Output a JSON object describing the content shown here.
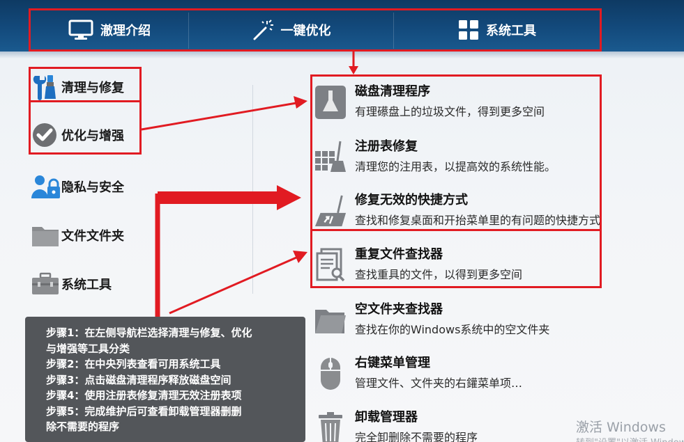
{
  "top_tabs": [
    {
      "label": "澈理介绍",
      "icon": "monitor-icon"
    },
    {
      "label": "一键优化",
      "icon": "magic-wand-icon"
    },
    {
      "label": "系统工具",
      "icon": "grid-icon"
    }
  ],
  "sidebar": {
    "items": [
      {
        "label": "清理与修复",
        "icon": "brush-wrench-icon"
      },
      {
        "label": "优化与增强",
        "icon": "check-circle-icon"
      },
      {
        "label": "隐私与安全",
        "icon": "user-lock-icon"
      },
      {
        "label": "文件文件夹",
        "icon": "folder-icon"
      },
      {
        "label": "系统工具",
        "icon": "toolbox-icon"
      }
    ]
  },
  "tools": [
    {
      "title": "磁盘清理程序",
      "desc": "有理礤盘上的垃圾文件，得到更多空间",
      "icon": "disk-cleanup-icon"
    },
    {
      "title": "注册表修复",
      "desc": "清理您的注用表，以提高效的系统性能。",
      "icon": "registry-repair-icon"
    },
    {
      "title": "修复无效的快捷方式",
      "desc": "查找和修复桌面和开抬菜单里的有问题的快捷方式",
      "icon": "shortcut-repair-icon"
    },
    {
      "title": "重复文件查找器",
      "desc": "查找重具的文件，以得到更多空间",
      "icon": "duplicate-file-icon"
    },
    {
      "title": "空文件夹查找器",
      "desc": "查找在你的Windows系统中的空文件夹",
      "icon": "empty-folder-icon"
    },
    {
      "title": "右键菜单管理",
      "desc": "管理文件、文件夹的右鑵菜单项…",
      "icon": "mouse-icon"
    },
    {
      "title": "卸载管理器",
      "desc": "完全卸删除不需要的程序",
      "icon": "trash-icon"
    }
  ],
  "steps": [
    "步骤1：在左侧导航栏选择清理与修复、优化",
    "与增强等工具分类",
    "步骤2：在中央列表查看可用系统工具",
    "步骤3：点击磁盘清理程序释放磁盘空间",
    "步骤4：使用注册表修复清理无效注册表项",
    "步骤5：完成维护后可查看卸载管理器删删",
    "除不需要的程序"
  ],
  "watermark": {
    "line1": "激活 Windows",
    "line2": "转到\"设置\"以激活 Windows"
  },
  "colors": {
    "header": "#134a7c",
    "highlight": "#e11b22",
    "steps_bg": "#46494e"
  }
}
